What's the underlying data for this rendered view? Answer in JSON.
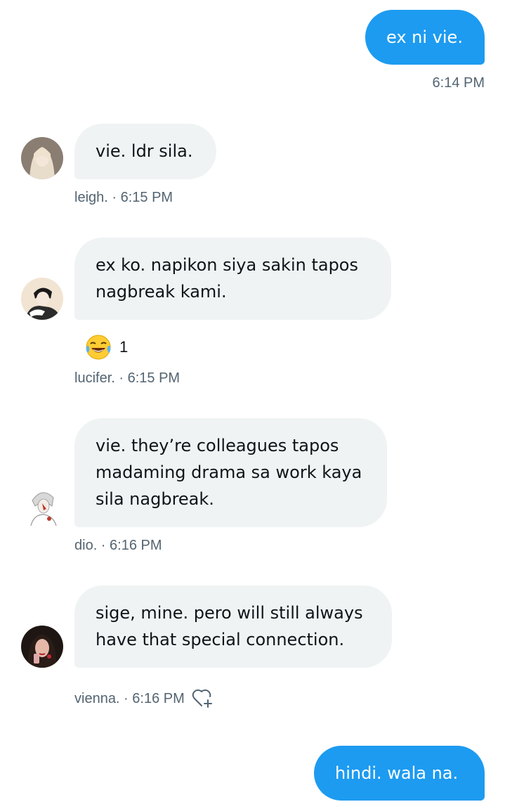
{
  "messages": [
    {
      "text": "ex ni vie.",
      "time": "6:14 PM"
    },
    {
      "text": "vie. ldr sila.",
      "sender": "leigh.",
      "time": "6:15 PM"
    },
    {
      "text": "ex ko. napikon siya sakin tapos nagbreak kami.",
      "sender": "lucifer.",
      "time": "6:15 PM",
      "reaction": {
        "emoji": "😂",
        "count": "1"
      }
    },
    {
      "text": "vie. they’re colleagues tapos madaming drama sa work kaya sila nagbreak.",
      "sender": "dio.",
      "time": "6:16 PM"
    },
    {
      "text": "sige, mine. pero will still always have that special connection.",
      "sender": "vienna.",
      "time": "6:16 PM"
    },
    {
      "text": "hindi. wala na."
    }
  ],
  "meta_separator": " · ",
  "icons": {
    "react": "heart-plus-icon"
  },
  "colors": {
    "accent": "#1d9bf0",
    "incoming_bubble": "#eff3f4",
    "meta_text": "#536471"
  }
}
